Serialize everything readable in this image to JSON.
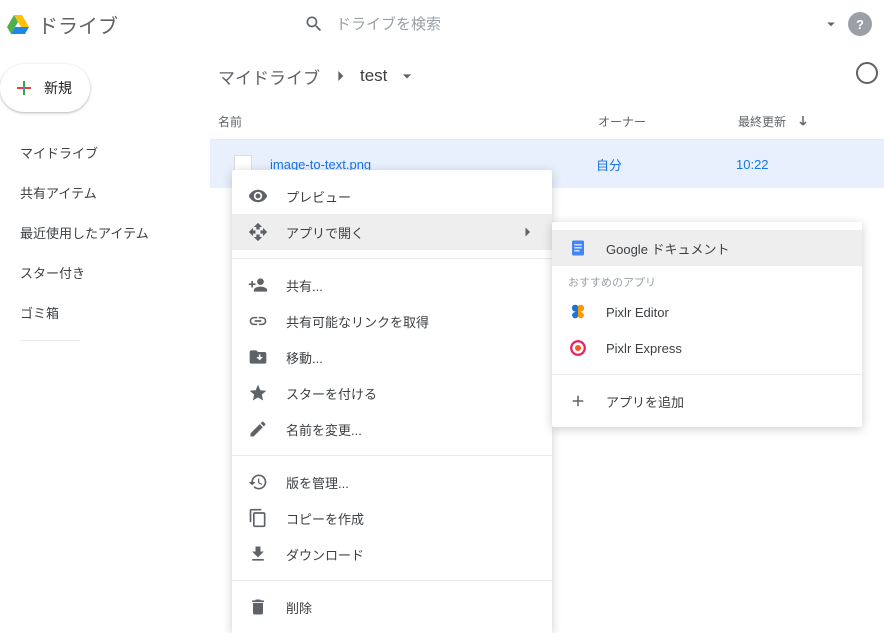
{
  "app": {
    "title": "ドライブ",
    "search_placeholder": "ドライブを検索"
  },
  "sidebar": {
    "new_label": "新規",
    "items": [
      {
        "label": "マイドライブ"
      },
      {
        "label": "共有アイテム"
      },
      {
        "label": "最近使用したアイテム"
      },
      {
        "label": "スター付き"
      },
      {
        "label": "ゴミ箱"
      }
    ]
  },
  "breadcrumb": {
    "root": "マイドライブ",
    "current": "test"
  },
  "columns": {
    "name": "名前",
    "owner": "オーナー",
    "modified": "最終更新"
  },
  "file": {
    "name": "image-to-text.png",
    "owner": "自分",
    "time": "10:22"
  },
  "context_menu": {
    "preview": "プレビュー",
    "open_with": "アプリで開く",
    "share": "共有...",
    "get_link": "共有可能なリンクを取得",
    "move": "移動...",
    "star": "スターを付ける",
    "rename": "名前を変更...",
    "manage_versions": "版を管理...",
    "make_copy": "コピーを作成",
    "download": "ダウンロード",
    "delete": "削除"
  },
  "submenu": {
    "gdocs": "Google ドキュメント",
    "recommended_header": "おすすめのアプリ",
    "pixlr_editor": "Pixlr Editor",
    "pixlr_express": "Pixlr Express",
    "add_app": "アプリを追加"
  }
}
